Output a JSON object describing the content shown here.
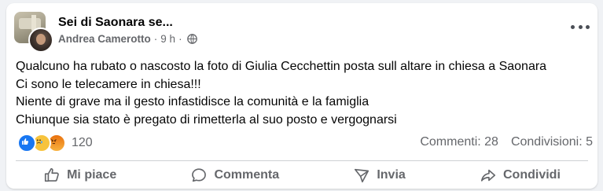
{
  "post": {
    "group_name": "Sei di Saonara se...",
    "author": "Andrea Camerotto",
    "separator": "·",
    "time": "9 h",
    "dot": "·",
    "text_lines": [
      "Qualcuno ha rubato o nascosto la foto di Giulia Cecchettin posta sull altare in chiesa a Saonara",
      "Ci sono le telecamere in chiesa!!!",
      "Niente di grave ma il gesto infastidisce la comunità e la famiglia",
      "Chiunque sia stato è pregato di rimetterla al suo posto e vergognarsi"
    ],
    "audience_icon": "globe-icon"
  },
  "engagement": {
    "reaction_icons": [
      "like-icon",
      "sad-icon",
      "angry-icon"
    ],
    "reaction_count": "120",
    "comments": "Commenti: 28",
    "shares": "Condivisioni: 5"
  },
  "actions": {
    "like": "Mi piace",
    "comment": "Commenta",
    "send": "Invia",
    "share": "Condividi"
  },
  "colors": {
    "background": "#f0f2f5",
    "card": "#ffffff",
    "text": "#050505",
    "secondary": "#65676b",
    "like_blue": "#1877f2"
  }
}
